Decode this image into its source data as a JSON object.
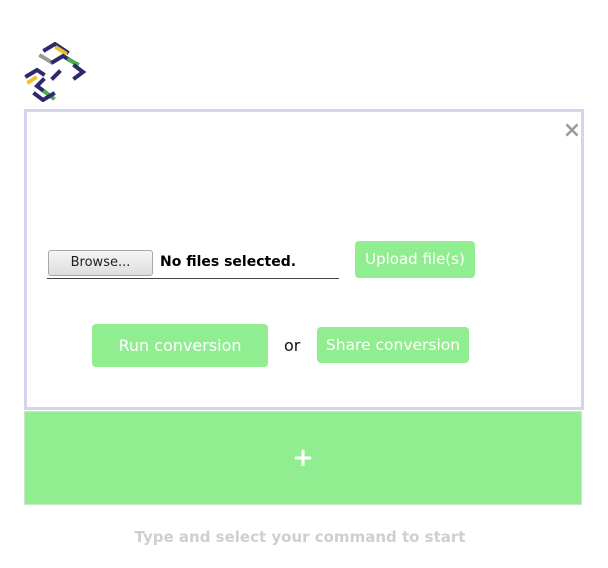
{
  "logo": {
    "icon": "app-logo-icon",
    "colors": [
      "#2c2a6b",
      "#f0c030",
      "#4cae4c",
      "#9a9a9a"
    ]
  },
  "panel": {
    "close_label": "×",
    "file_input": {
      "browse_label": "Browse...",
      "status": "No files selected."
    },
    "upload_label": "Upload file(s)",
    "run_label": "Run conversion",
    "or_label": "or",
    "share_label": "Share conversion"
  },
  "add_bar": {
    "label": "+"
  },
  "hint": "Type and select your command to start",
  "colors": {
    "accent_green": "#90ee90",
    "panel_border": "#d6d3ec",
    "hint_text": "#cfcfcf"
  }
}
